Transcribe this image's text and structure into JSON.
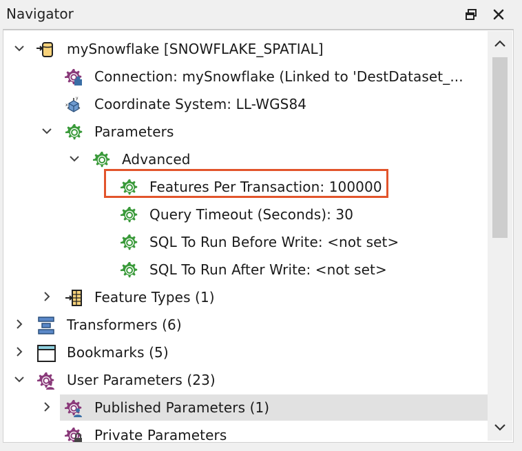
{
  "window": {
    "title": "Navigator",
    "restore_icon": "restore-window-icon",
    "close_icon": "close-icon"
  },
  "colors": {
    "highlight": "#e2542b",
    "selection": "#e1e1e1",
    "gear": "#3a9a3a",
    "gear_purple": "#8a3a7a"
  },
  "tree": {
    "root": {
      "label": "mySnowflake [SNOWFLAKE_SPATIAL]",
      "icon": "database-writer-icon"
    },
    "connection": {
      "label": "Connection: mySnowflake (Linked to 'DestDataset_...",
      "icon": "connection-gear-icon"
    },
    "coordsys": {
      "label": "Coordinate System: LL-WGS84",
      "icon": "coordinate-system-icon"
    },
    "parameters": {
      "label": "Parameters",
      "icon": "gear-icon"
    },
    "advanced": {
      "label": "Advanced",
      "icon": "gear-icon"
    },
    "features_per_txn": {
      "label": "Features Per Transaction: 100000",
      "icon": "gear-icon"
    },
    "query_timeout": {
      "label": "Query Timeout (Seconds): 30",
      "icon": "gear-icon"
    },
    "sql_before": {
      "label": "SQL To Run Before Write: <not set>",
      "icon": "gear-icon"
    },
    "sql_after": {
      "label": "SQL To Run After Write: <not set>",
      "icon": "gear-icon"
    },
    "feature_types": {
      "label": "Feature Types (1)",
      "icon": "feature-types-icon"
    },
    "transformers": {
      "label": "Transformers (6)",
      "icon": "transformers-icon"
    },
    "bookmarks": {
      "label": "Bookmarks (5)",
      "icon": "bookmark-icon"
    },
    "user_params": {
      "label": "User Parameters (23)",
      "icon": "user-parameters-icon"
    },
    "published_params": {
      "label": "Published Parameters (1)",
      "icon": "published-parameters-icon"
    },
    "private_params": {
      "label": "Private Parameters",
      "icon": "private-parameters-icon"
    }
  }
}
